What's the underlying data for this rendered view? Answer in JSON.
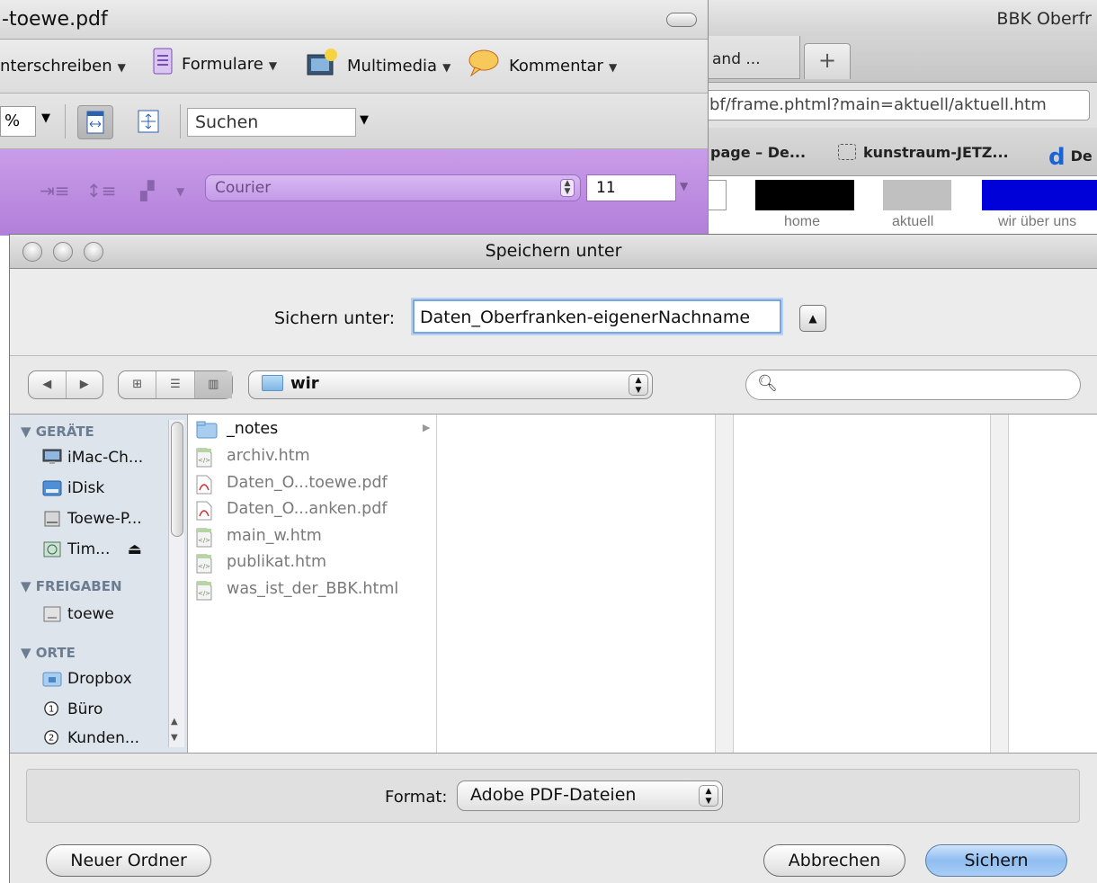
{
  "browser": {
    "window_title": "BBK Oberfr",
    "tab_label": "and ...",
    "new_tab_label": "+",
    "url": "bf/frame.phtml?main=aktuell/aktuell.htm",
    "bookmarks": [
      "page – De...",
      "kunstraum-JETZ...",
      "De"
    ],
    "site_nav": [
      "home",
      "aktuell",
      "wir über uns"
    ]
  },
  "acrobat": {
    "window_title": "-toewe.pdf",
    "toolbar": {
      "sign_label": "nterschreiben",
      "forms_label": "Formulare",
      "multimedia_label": "Multimedia",
      "comment_label": "Kommentar"
    },
    "zoom_value": "%",
    "search_placeholder": "Suchen",
    "font_name": "Courier",
    "font_size": "11"
  },
  "dialog": {
    "title": "Speichern unter",
    "save_as_label": "Sichern unter:",
    "filename": "Daten_Oberfranken-eigenerNachname",
    "current_folder": "wir",
    "search_placeholder": "",
    "sidebar": {
      "sections": [
        {
          "title": "GERÄTE",
          "items": [
            "iMac-Ch...",
            "iDisk",
            "Toewe-P...",
            "Tim..."
          ]
        },
        {
          "title": "FREIGABEN",
          "items": [
            "toewe"
          ]
        },
        {
          "title": "ORTE",
          "items": [
            "Dropbox",
            "Büro",
            "Kunden..."
          ]
        }
      ]
    },
    "files": [
      {
        "name": "_notes",
        "kind": "folder",
        "enabled": true
      },
      {
        "name": "archiv.htm",
        "kind": "html",
        "enabled": false
      },
      {
        "name": "Daten_O...toewe.pdf",
        "kind": "pdf",
        "enabled": false
      },
      {
        "name": "Daten_O...anken.pdf",
        "kind": "pdf",
        "enabled": false
      },
      {
        "name": "main_w.htm",
        "kind": "html",
        "enabled": false
      },
      {
        "name": "publikat.htm",
        "kind": "html",
        "enabled": false
      },
      {
        "name": "was_ist_der_BBK.html",
        "kind": "html",
        "enabled": false
      }
    ],
    "format_label": "Format:",
    "format_value": "Adobe PDF-Dateien",
    "new_folder_button": "Neuer Ordner",
    "cancel_button": "Abbrechen",
    "save_button": "Sichern"
  },
  "colors": {
    "acrobat_format_bar": "#b27fd9",
    "sidebar_bg": "#dde4ec",
    "sidebar_heading": "#6c7d91",
    "default_button": "#8fbdf1",
    "site_nav_home": "#000000",
    "site_nav_aktuell": "#c0c0c0",
    "site_nav_wir": "#0000d8"
  }
}
